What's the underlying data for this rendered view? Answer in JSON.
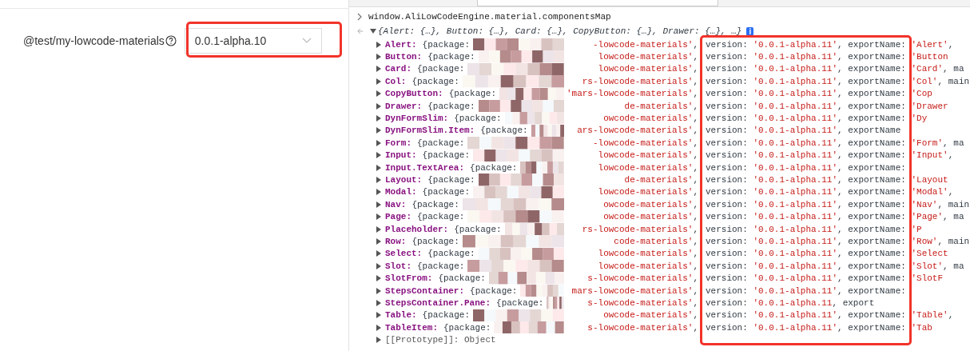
{
  "settings": {
    "label": "@test/my-lowcode-materials",
    "select_value": "0.0.1-alpha.10"
  },
  "console": {
    "command": "window.AliLowCodeEngine.material.componentsMap",
    "summary": "{Alert: {…}, Button: {…}, Card: {…}, CopyButton: {…}, Drawer: {…}, …}",
    "info_badge": "i",
    "rows": [
      {
        "key": "Alert:",
        "before": "{package:",
        "after": [
          {
            "kind": "str",
            "text": "-lowcode-materials'"
          },
          {
            "kind": "plain",
            "text": ","
          },
          {
            "kind": "plain",
            "text": "version: "
          },
          {
            "kind": "str",
            "text": "'0.0.1-alpha.11'"
          },
          {
            "kind": "plain",
            "text": ", exportName: "
          },
          {
            "kind": "str",
            "text": "'Alert'"
          },
          {
            "kind": "plain",
            "text": ","
          }
        ]
      },
      {
        "key": "Button:",
        "before": "{package:",
        "after": [
          {
            "kind": "str",
            "text": "lowcode-materials'"
          },
          {
            "kind": "plain",
            "text": ","
          },
          {
            "kind": "plain",
            "text": "version: "
          },
          {
            "kind": "str",
            "text": "'0.0.1-alpha.11'"
          },
          {
            "kind": "plain",
            "text": ", exportName: "
          },
          {
            "kind": "str",
            "text": "'Button"
          }
        ]
      },
      {
        "key": "Card:",
        "before": "{package:",
        "after": [
          {
            "kind": "str",
            "text": "lowcode-materials'"
          },
          {
            "kind": "plain",
            "text": ","
          },
          {
            "kind": "plain",
            "text": "version: "
          },
          {
            "kind": "str",
            "text": "'0.0.1-alpha.11'"
          },
          {
            "kind": "plain",
            "text": ", exportName: "
          },
          {
            "kind": "str",
            "text": "'Card'"
          },
          {
            "kind": "plain",
            "text": ", ma"
          }
        ]
      },
      {
        "key": "Col:",
        "before": "{package:",
        "after": [
          {
            "kind": "str",
            "text": "rs-lowcode-materials'"
          },
          {
            "kind": "plain",
            "text": ","
          },
          {
            "kind": "plain",
            "text": "version: "
          },
          {
            "kind": "str",
            "text": "'0.0.1-alpha.11'"
          },
          {
            "kind": "plain",
            "text": ", exportName: "
          },
          {
            "kind": "str",
            "text": "'Col'"
          },
          {
            "kind": "plain",
            "text": ", main"
          }
        ]
      },
      {
        "key": "CopyButton:",
        "before": "{package:",
        "after": [
          {
            "kind": "str",
            "text": "'mars-lowcode-materials'"
          },
          {
            "kind": "plain",
            "text": ","
          },
          {
            "kind": "plain",
            "text": "version: "
          },
          {
            "kind": "str",
            "text": "'0.0.1-alpha.11'"
          },
          {
            "kind": "plain",
            "text": ", exportName: "
          },
          {
            "kind": "str",
            "text": "'Cop"
          }
        ]
      },
      {
        "key": "Drawer:",
        "before": "{package:",
        "after": [
          {
            "kind": "str",
            "text": "de-materials'"
          },
          {
            "kind": "plain",
            "text": ","
          },
          {
            "kind": "plain",
            "text": "version: "
          },
          {
            "kind": "str",
            "text": "'0.0.1-alpha.11'"
          },
          {
            "kind": "plain",
            "text": ", exportName: "
          },
          {
            "kind": "str",
            "text": "'Drawer"
          }
        ]
      },
      {
        "key": "DynFormSlim:",
        "before": "{package:",
        "after": [
          {
            "kind": "str",
            "text": "owcode-materials'"
          },
          {
            "kind": "plain",
            "text": ","
          },
          {
            "kind": "plain",
            "text": "version: "
          },
          {
            "kind": "str",
            "text": "'0.0.1-alpha.11'"
          },
          {
            "kind": "plain",
            "text": ", exportName: "
          },
          {
            "kind": "str",
            "text": "'Dy"
          }
        ]
      },
      {
        "key": "DynFormSlim.Item:",
        "before": "{package:",
        "after": [
          {
            "kind": "str",
            "text": "ars-lowcode-materials'"
          },
          {
            "kind": "plain",
            "text": ","
          },
          {
            "kind": "plain",
            "text": "version: "
          },
          {
            "kind": "str",
            "text": "'0.0.1-alpha.11'"
          },
          {
            "kind": "plain",
            "text": ", exportName"
          }
        ]
      },
      {
        "key": "Form:",
        "before": "{package:",
        "after": [
          {
            "kind": "str",
            "text": "-lowcode-materials'"
          },
          {
            "kind": "plain",
            "text": ","
          },
          {
            "kind": "plain",
            "text": "version: "
          },
          {
            "kind": "str",
            "text": "'0.0.1-alpha.11'"
          },
          {
            "kind": "plain",
            "text": ", exportName: "
          },
          {
            "kind": "str",
            "text": "'Form'"
          },
          {
            "kind": "plain",
            "text": ", ma"
          }
        ]
      },
      {
        "key": "Input:",
        "before": "{package:",
        "after": [
          {
            "kind": "str",
            "text": "lowcode-materials'"
          },
          {
            "kind": "plain",
            "text": ","
          },
          {
            "kind": "plain",
            "text": "version: "
          },
          {
            "kind": "str",
            "text": "'0.0.1-alpha.11'"
          },
          {
            "kind": "plain",
            "text": ", exportName: "
          },
          {
            "kind": "str",
            "text": "'Input'"
          },
          {
            "kind": "plain",
            "text": ","
          }
        ]
      },
      {
        "key": "Input.TextArea:",
        "before": "{package:",
        "after": [
          {
            "kind": "str",
            "text": "lowcode-materials'"
          },
          {
            "kind": "plain",
            "text": ","
          },
          {
            "kind": "plain",
            "text": "version: "
          },
          {
            "kind": "str",
            "text": "'0.0.1-alpha.11'"
          },
          {
            "kind": "plain",
            "text": ", exportName:"
          }
        ]
      },
      {
        "key": "Layout:",
        "before": "{package:",
        "after": [
          {
            "kind": "str",
            "text": "de-materials'"
          },
          {
            "kind": "plain",
            "text": ","
          },
          {
            "kind": "plain",
            "text": "version: "
          },
          {
            "kind": "str",
            "text": "'0.0.1-alpha.11'"
          },
          {
            "kind": "plain",
            "text": ", exportName: "
          },
          {
            "kind": "str",
            "text": "'Layout"
          }
        ]
      },
      {
        "key": "Modal:",
        "before": "{package:",
        "after": [
          {
            "kind": "str",
            "text": "lowcode-materials'"
          },
          {
            "kind": "plain",
            "text": ","
          },
          {
            "kind": "plain",
            "text": "version: "
          },
          {
            "kind": "str",
            "text": "'0.0.1-alpha.11'"
          },
          {
            "kind": "plain",
            "text": ", exportName: "
          },
          {
            "kind": "str",
            "text": "'Modal'"
          },
          {
            "kind": "plain",
            "text": ","
          }
        ]
      },
      {
        "key": "Nav:",
        "before": "{package:",
        "after": [
          {
            "kind": "str",
            "text": "owcode-materials'"
          },
          {
            "kind": "plain",
            "text": ","
          },
          {
            "kind": "plain",
            "text": "version: "
          },
          {
            "kind": "str",
            "text": "'0.0.1-alpha.11'"
          },
          {
            "kind": "plain",
            "text": ", exportName: "
          },
          {
            "kind": "str",
            "text": "'Nav'"
          },
          {
            "kind": "plain",
            "text": ", main"
          }
        ]
      },
      {
        "key": "Page:",
        "before": "{package:",
        "after": [
          {
            "kind": "str",
            "text": "owcode-materials'"
          },
          {
            "kind": "plain",
            "text": ","
          },
          {
            "kind": "plain",
            "text": "version: "
          },
          {
            "kind": "str",
            "text": "'0.0.1-alpha.11'"
          },
          {
            "kind": "plain",
            "text": ", exportName: "
          },
          {
            "kind": "str",
            "text": "'Page'"
          },
          {
            "kind": "plain",
            "text": ", ma"
          }
        ]
      },
      {
        "key": "Placeholder:",
        "before": "{package:",
        "after": [
          {
            "kind": "str",
            "text": "rs-lowcode-materials'"
          },
          {
            "kind": "plain",
            "text": ","
          },
          {
            "kind": "plain",
            "text": "version: "
          },
          {
            "kind": "str",
            "text": "'0.0.1-alpha.11'"
          },
          {
            "kind": "plain",
            "text": ", exportName: "
          },
          {
            "kind": "str",
            "text": "'P"
          }
        ]
      },
      {
        "key": "Row:",
        "before": "{package:",
        "after": [
          {
            "kind": "str",
            "text": "code-materials'"
          },
          {
            "kind": "plain",
            "text": ","
          },
          {
            "kind": "plain",
            "text": "version: "
          },
          {
            "kind": "str",
            "text": "'0.0.1-alpha.11'"
          },
          {
            "kind": "plain",
            "text": ", exportName: "
          },
          {
            "kind": "str",
            "text": "'Row'"
          },
          {
            "kind": "plain",
            "text": ", main"
          }
        ]
      },
      {
        "key": "Select:",
        "before": "{package:",
        "after": [
          {
            "kind": "str",
            "text": "lowcode-materials'"
          },
          {
            "kind": "plain",
            "text": ","
          },
          {
            "kind": "plain",
            "text": "version: "
          },
          {
            "kind": "str",
            "text": "'0.0.1-alpha.11'"
          },
          {
            "kind": "plain",
            "text": ", exportName: "
          },
          {
            "kind": "str",
            "text": "'Select"
          }
        ]
      },
      {
        "key": "Slot:",
        "before": "{package:",
        "after": [
          {
            "kind": "str",
            "text": "lowcode-materials'"
          },
          {
            "kind": "plain",
            "text": ","
          },
          {
            "kind": "plain",
            "text": "version: "
          },
          {
            "kind": "str",
            "text": "'0.0.1-alpha.11'"
          },
          {
            "kind": "plain",
            "text": ", exportName: "
          },
          {
            "kind": "str",
            "text": "'Slot'"
          },
          {
            "kind": "plain",
            "text": ", ma"
          }
        ]
      },
      {
        "key": "SlotFrom:",
        "before": "{package:",
        "after": [
          {
            "kind": "str",
            "text": "s-lowcode-materials'"
          },
          {
            "kind": "plain",
            "text": ","
          },
          {
            "kind": "plain",
            "text": "version: "
          },
          {
            "kind": "str",
            "text": "'0.0.1-alpha.11'"
          },
          {
            "kind": "plain",
            "text": ", exportName: "
          },
          {
            "kind": "str",
            "text": "'SlotF"
          }
        ]
      },
      {
        "key": "StepsContainer:",
        "before": "{package:",
        "after": [
          {
            "kind": "str",
            "text": "mars-lowcode-materials'"
          },
          {
            "kind": "plain",
            "text": ","
          },
          {
            "kind": "plain",
            "text": "version: "
          },
          {
            "kind": "str",
            "text": "'0.0.1-alpha.11'"
          },
          {
            "kind": "plain",
            "text": ", exportName:"
          }
        ]
      },
      {
        "key": "StepsContainer.Pane:",
        "before": "{package:",
        "after": [
          {
            "kind": "str",
            "text": "s-lowcode-materials'"
          },
          {
            "kind": "plain",
            "text": ","
          },
          {
            "kind": "plain",
            "text": "version: "
          },
          {
            "kind": "str",
            "text": "'0.0.1-alpha.11"
          },
          {
            "kind": "plain",
            "text": ", export"
          }
        ]
      },
      {
        "key": "Table:",
        "before": "{package:",
        "after": [
          {
            "kind": "str",
            "text": "owcode-materials'"
          },
          {
            "kind": "plain",
            "text": ","
          },
          {
            "kind": "plain",
            "text": "version: "
          },
          {
            "kind": "str",
            "text": "'0.0.1-alpha.11'"
          },
          {
            "kind": "plain",
            "text": ", exportName: "
          },
          {
            "kind": "str",
            "text": "'Table'"
          },
          {
            "kind": "plain",
            "text": ","
          }
        ]
      },
      {
        "key": "TableItem:",
        "before": "{package:",
        "after": [
          {
            "kind": "str",
            "text": "s-lowcode-materials'"
          },
          {
            "kind": "plain",
            "text": ","
          },
          {
            "kind": "plain",
            "text": "version: "
          },
          {
            "kind": "str",
            "text": "'0.0.1-alpha.11'"
          },
          {
            "kind": "plain",
            "text": ", exportName: "
          },
          {
            "kind": "str",
            "text": "'Tab"
          }
        ]
      }
    ],
    "prototype": "[[Prototype]]: Object"
  }
}
